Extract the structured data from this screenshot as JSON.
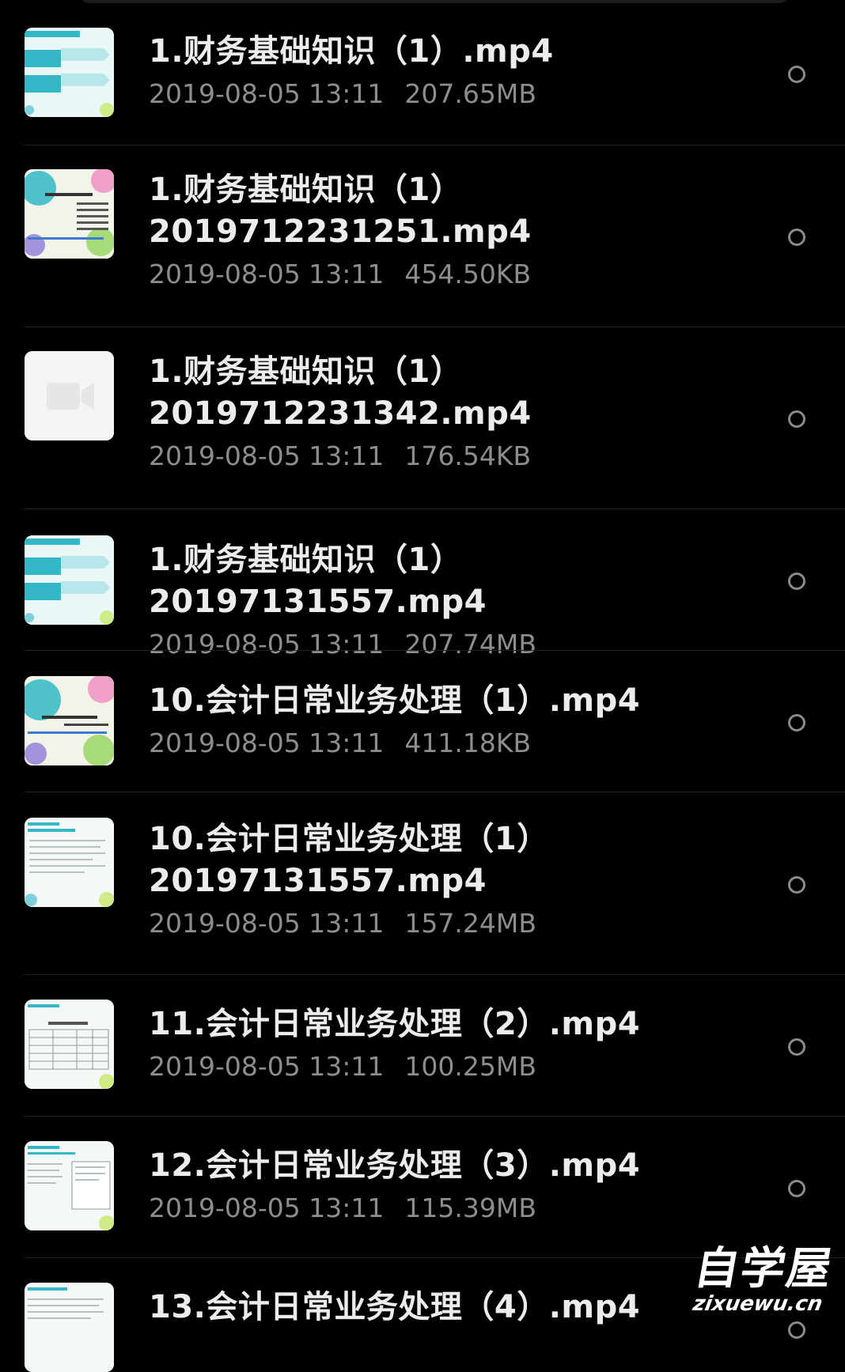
{
  "files": [
    {
      "title": "1.财务基础知识（1）.mp4",
      "date": "2019-08-05  13:11",
      "size": "207.65MB",
      "thumb_icon": "slide-thumbnail-icon"
    },
    {
      "title": "1.财务基础知识（1）\n2019712231251.mp4",
      "date": "2019-08-05  13:11",
      "size": "454.50KB",
      "thumb_icon": "slide-thumbnail-icon"
    },
    {
      "title": "1.财务基础知识（1）\n2019712231342.mp4",
      "date": "2019-08-05  13:11",
      "size": "176.54KB",
      "thumb_icon": "video-placeholder-icon"
    },
    {
      "title": "1.财务基础知识（1）20197131557.mp4",
      "date": "2019-08-05  13:11",
      "size": "207.74MB",
      "thumb_icon": "slide-thumbnail-icon"
    },
    {
      "title": "10.会计日常业务处理（1）.mp4",
      "date": "2019-08-05  13:11",
      "size": "411.18KB",
      "thumb_icon": "slide-thumbnail-icon"
    },
    {
      "title": "10.会计日常业务处理（1）\n20197131557.mp4",
      "date": "2019-08-05  13:11",
      "size": "157.24MB",
      "thumb_icon": "slide-thumbnail-icon"
    },
    {
      "title": "11.会计日常业务处理（2）.mp4",
      "date": "2019-08-05  13:11",
      "size": "100.25MB",
      "thumb_icon": "slide-thumbnail-icon"
    },
    {
      "title": "12.会计日常业务处理（3）.mp4",
      "date": "2019-08-05  13:11",
      "size": "115.39MB",
      "thumb_icon": "slide-thumbnail-icon"
    },
    {
      "title": "13.会计日常业务处理（4）.mp4",
      "date": "",
      "size": "",
      "thumb_icon": "slide-thumbnail-icon"
    }
  ],
  "watermark": {
    "cn": "自学屋",
    "en": "zixuewu.cn"
  },
  "colors": {
    "background": "#000000",
    "title": "#ececec",
    "meta": "#8d8d8d",
    "radio": "#8a8a8a",
    "thumb_accent": "#36b7c7"
  }
}
